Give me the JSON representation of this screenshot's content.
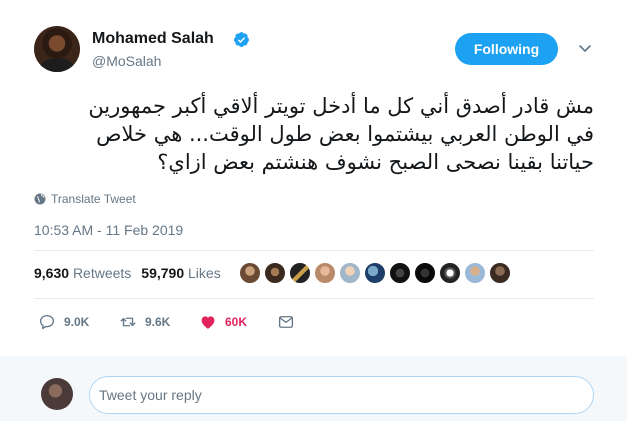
{
  "header": {
    "name": "Mohamed Salah",
    "handle": "@MoSalah",
    "follow_label": "Following",
    "accent_color": "#1da1f2"
  },
  "tweet": {
    "lines": [
      "مش قادر أصدق أني كل ما أدخل تويتر ألاقي أكبر جمهورين",
      "في الوطن العربي بيشتموا بعض طول الوقت... هي خلاص",
      "حياتنا بقينا نصحى الصبح نشوف هنشتم بعض ازاي؟"
    ],
    "translate_label": "Translate Tweet",
    "timestamp": "10:53 AM - 11 Feb 2019"
  },
  "stats": {
    "retweets_count": "9,630",
    "retweets_label": "Retweets",
    "likes_count": "59,790",
    "likes_label": "Likes"
  },
  "actions": {
    "reply_count": "9.0K",
    "retweet_count": "9.6K",
    "like_count": "60K",
    "like_color": "#e0245e"
  },
  "reply": {
    "placeholder": "Tweet your reply"
  }
}
